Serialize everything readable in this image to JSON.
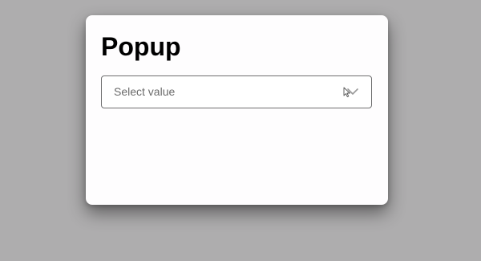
{
  "popup": {
    "title": "Popup",
    "select": {
      "placeholder": "Select value"
    }
  }
}
